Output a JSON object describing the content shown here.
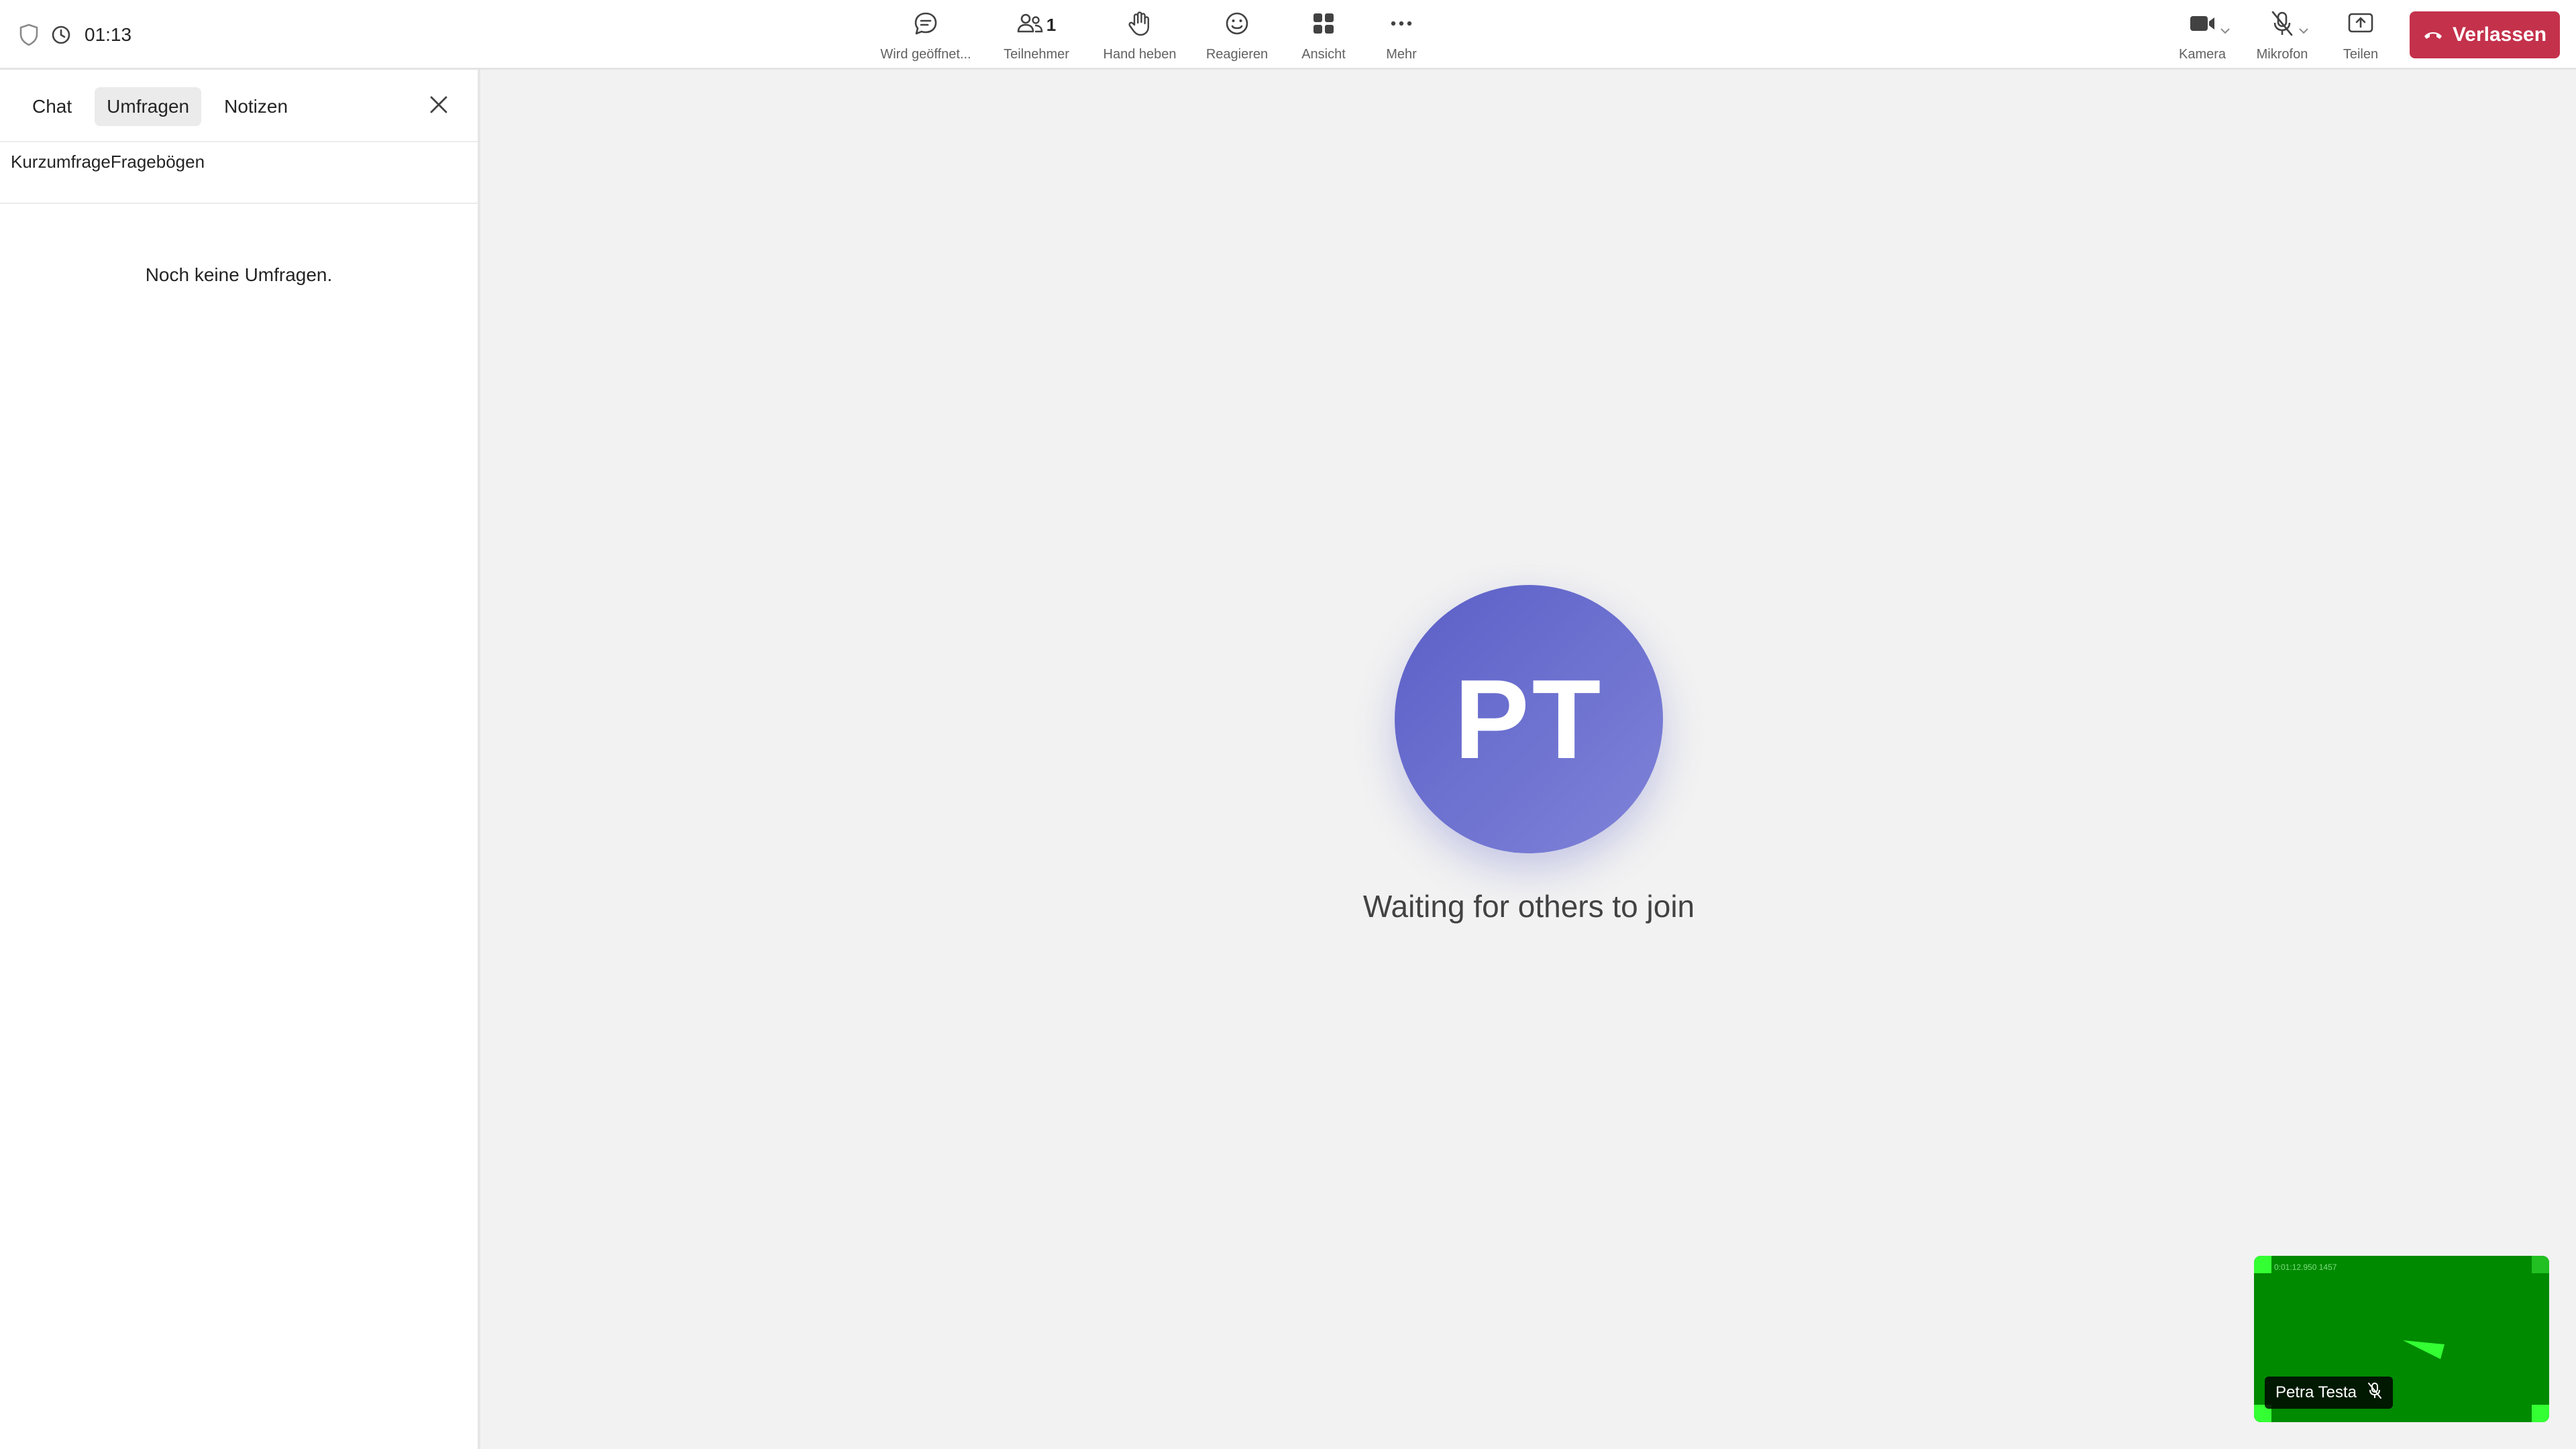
{
  "meeting": {
    "timer": "01:13"
  },
  "toolbar": {
    "center": [
      {
        "label": "Wird geöffnet...",
        "icon": "chat-icon"
      },
      {
        "label": "Teilnehmer",
        "icon": "people-icon",
        "count": "1"
      },
      {
        "label": "Hand heben",
        "icon": "hand-icon"
      },
      {
        "label": "Reagieren",
        "icon": "smiley-icon"
      },
      {
        "label": "Ansicht",
        "icon": "grid-icon"
      },
      {
        "label": "Mehr",
        "icon": "more-icon"
      }
    ],
    "right": [
      {
        "label": "Kamera",
        "icon": "camera-icon"
      },
      {
        "label": "Mikrofon",
        "icon": "mic-off-icon"
      },
      {
        "label": "Teilen",
        "icon": "share-icon"
      }
    ],
    "leave_label": "Verlassen",
    "leave_color": "#c4314b"
  },
  "panel": {
    "tabs": [
      "Chat",
      "Umfragen",
      "Notizen"
    ],
    "active_tab": "Umfragen",
    "subtabs": [
      "Kurzumfrage",
      "Fragebögen"
    ],
    "empty_text": "Noch keine Umfragen."
  },
  "stage": {
    "initials": "PT",
    "waiting_text": "Waiting for others to join",
    "avatar_color": "#5b5fc7"
  },
  "self_view": {
    "name": "Petra Testa",
    "overlay_text": "0:01:12.950 1457",
    "background_color": "#008a00"
  }
}
